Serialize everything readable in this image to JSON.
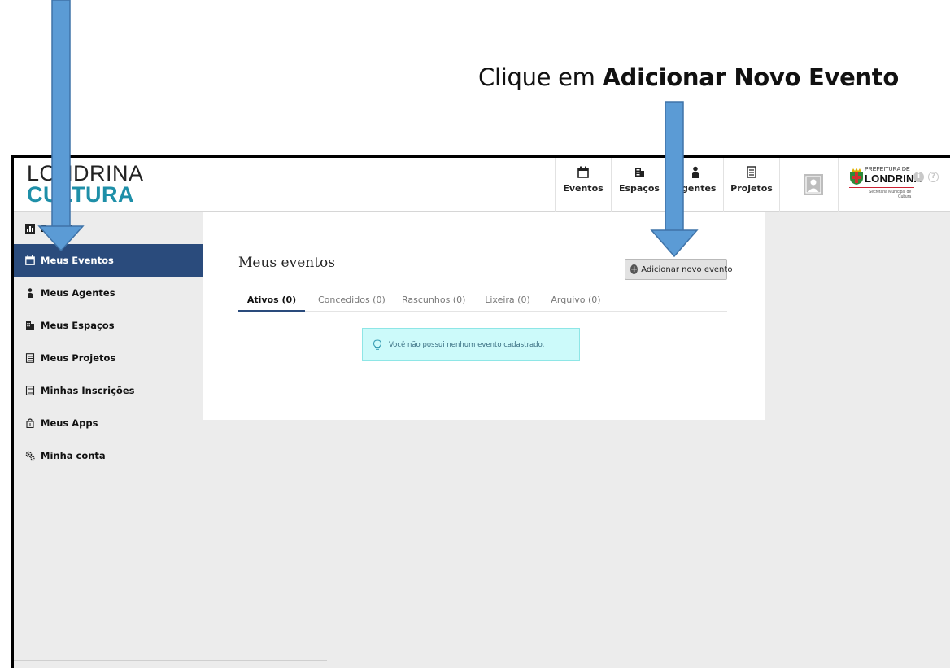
{
  "instruction": {
    "prefix": "Clique em ",
    "bold": "Adicionar Novo Evento"
  },
  "header": {
    "logo_line1": "LONDRINA",
    "logo_line2": "CULTURA",
    "nav": [
      {
        "label": "Eventos",
        "icon": "calendar-icon"
      },
      {
        "label": "Espaços",
        "icon": "building-icon"
      },
      {
        "label": "Agentes",
        "icon": "person-icon"
      },
      {
        "label": "Projetos",
        "icon": "document-icon"
      }
    ],
    "prefeitura": {
      "line1": "PREFEITURA DE",
      "line2": "LONDRINA",
      "line3": "Secretaria Municipal de",
      "line4": "Cultura"
    },
    "info_glyph": "i",
    "help_glyph": "?"
  },
  "sidebar": {
    "items": [
      {
        "label": "Painel",
        "icon": "chart-icon",
        "active": false
      },
      {
        "label": "Meus Eventos",
        "icon": "calendar-icon",
        "active": true
      },
      {
        "label": "Meus Agentes",
        "icon": "person-icon",
        "active": false
      },
      {
        "label": "Meus Espaços",
        "icon": "building-icon",
        "active": false
      },
      {
        "label": "Meus Projetos",
        "icon": "document-icon",
        "active": false
      },
      {
        "label": "Minhas Inscrições",
        "icon": "document-icon",
        "active": false
      },
      {
        "label": "Meus Apps",
        "icon": "apps-icon",
        "active": false
      },
      {
        "label": "Minha conta",
        "icon": "gears-icon",
        "active": false
      }
    ]
  },
  "main": {
    "title": "Meus eventos",
    "add_button": "Adicionar novo evento",
    "tabs": [
      {
        "label": "Ativos (0)",
        "active": true
      },
      {
        "label": "Concedidos (0)",
        "active": false
      },
      {
        "label": "Rascunhos (0)",
        "active": false
      },
      {
        "label": "Lixeira (0)",
        "active": false
      },
      {
        "label": "Arquivo (0)",
        "active": false
      }
    ],
    "empty_message": "Você não possui nenhum evento cadastrado."
  },
  "colors": {
    "accent": "#2a4b7c",
    "logo_teal": "#1e8fa8",
    "arrow": "#5b9bd5",
    "alert_bg": "#ccfafa"
  }
}
